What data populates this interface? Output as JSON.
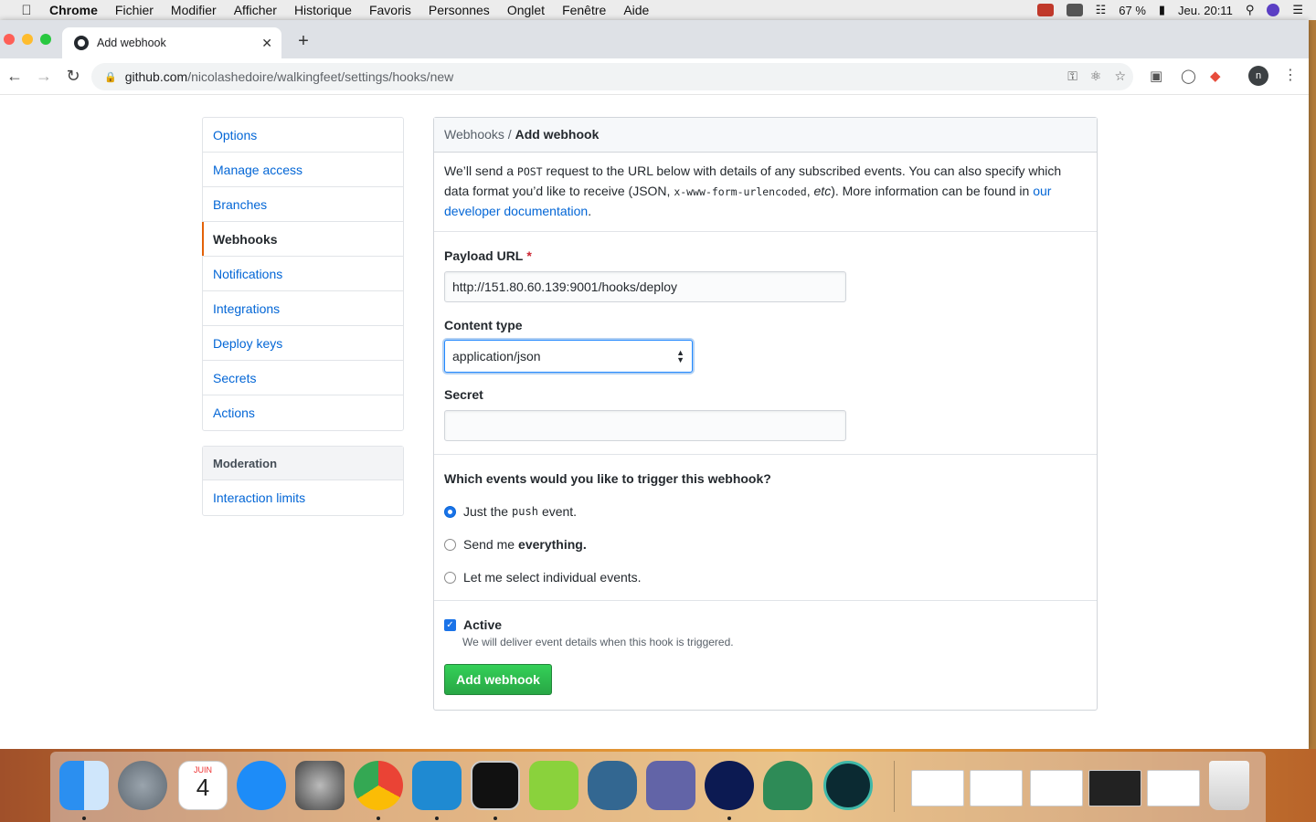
{
  "menubar": {
    "app": "Chrome",
    "items": [
      "Fichier",
      "Modifier",
      "Afficher",
      "Historique",
      "Favoris",
      "Personnes",
      "Onglet",
      "Fenêtre",
      "Aide"
    ],
    "battery": "67 %",
    "clock": "Jeu. 20:11"
  },
  "browser": {
    "tab_title": "Add webhook",
    "url_host": "github.com",
    "url_path": "/nicolashedoire/walkingfeet/settings/hooks/new",
    "avatar_initial": "n"
  },
  "sidebar": {
    "items": [
      {
        "label": "Options",
        "selected": false
      },
      {
        "label": "Manage access",
        "selected": false
      },
      {
        "label": "Branches",
        "selected": false
      },
      {
        "label": "Webhooks",
        "selected": true
      },
      {
        "label": "Notifications",
        "selected": false
      },
      {
        "label": "Integrations",
        "selected": false
      },
      {
        "label": "Deploy keys",
        "selected": false
      },
      {
        "label": "Secrets",
        "selected": false
      },
      {
        "label": "Actions",
        "selected": false
      }
    ],
    "moderation_heading": "Moderation",
    "moderation_items": [
      "Interaction limits"
    ]
  },
  "form": {
    "breadcrumb_parent": "Webhooks",
    "breadcrumb_sep": " / ",
    "breadcrumb_current": "Add webhook",
    "intro_1": "We’ll send a ",
    "intro_code_post": "POST",
    "intro_2": " request to the URL below with details of any subscribed events. You can also specify which data format you’d like to receive (JSON, ",
    "intro_code_form": "x-www-form-urlencoded",
    "intro_3": ", ",
    "intro_etc": "etc",
    "intro_4": "). More information can be found in ",
    "intro_link": "our developer documentation",
    "intro_5": ".",
    "payload_label": "Payload URL",
    "required_mark": "*",
    "payload_value": "http://151.80.60.139:9001/hooks/deploy",
    "content_type_label": "Content type",
    "content_type_value": "application/json",
    "secret_label": "Secret",
    "secret_value": "",
    "events_question": "Which events would you like to trigger this webhook?",
    "event_push_pre": "Just the",
    "event_push_code": "push",
    "event_push_post": "event.",
    "event_all_pre": "Send me",
    "event_all_bold": "everything.",
    "event_select": "Let me select individual events.",
    "selected_event": "push",
    "active_label": "Active",
    "active_checked": true,
    "active_note": "We will deliver event details when this hook is triggered.",
    "submit_label": "Add webhook"
  },
  "dock": {
    "calendar_month": "JUIN",
    "calendar_day": "4"
  },
  "colors": {
    "link": "#0366d6",
    "selected_accent": "#e36209",
    "primary_button": "#2ea44f",
    "required": "#cb2431"
  }
}
